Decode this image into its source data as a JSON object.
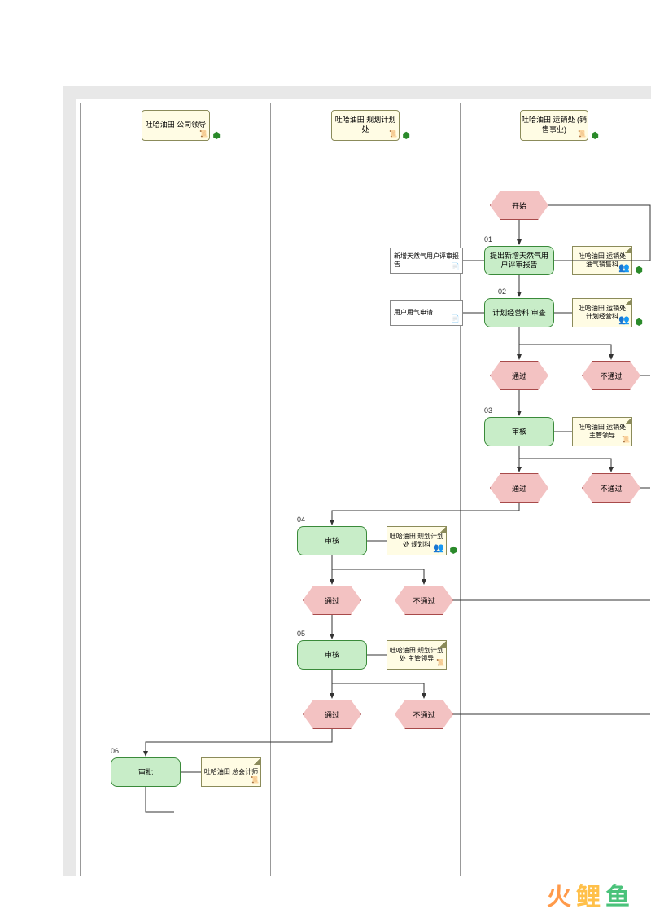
{
  "lanes": {
    "l1": "吐哈油田\n公司领导",
    "l2": "吐哈油田\n规划计划处",
    "l3": "吐哈油田\n运销处\n(销售事业)"
  },
  "nodes": {
    "start": "开始",
    "p01": "提出新增天然气用户评审报告",
    "p02": "计划经营科 审查",
    "p03": "审核",
    "p04": "审核",
    "p05": "审核",
    "p06": "审批",
    "pass": "通过",
    "fail": "不通过"
  },
  "docs": {
    "d1": "新增天然气用户评审报告",
    "d2": "用户用气申请"
  },
  "notes": {
    "n01": "吐哈油田\n运销处\n油气销售科",
    "n02": "吐哈油田\n运销处\n计划经营科",
    "n03": "吐哈油田\n运销处\n主管领导",
    "n04": "吐哈油田\n规划计划处\n规划科",
    "n05": "吐哈油田\n规划计划处\n主管领导",
    "n06": "吐哈油田\n总会计师"
  },
  "nums": {
    "s01": "01",
    "s02": "02",
    "s03": "03",
    "s04": "04",
    "s05": "05",
    "s06": "06"
  },
  "watermark": "火鲤鱼"
}
